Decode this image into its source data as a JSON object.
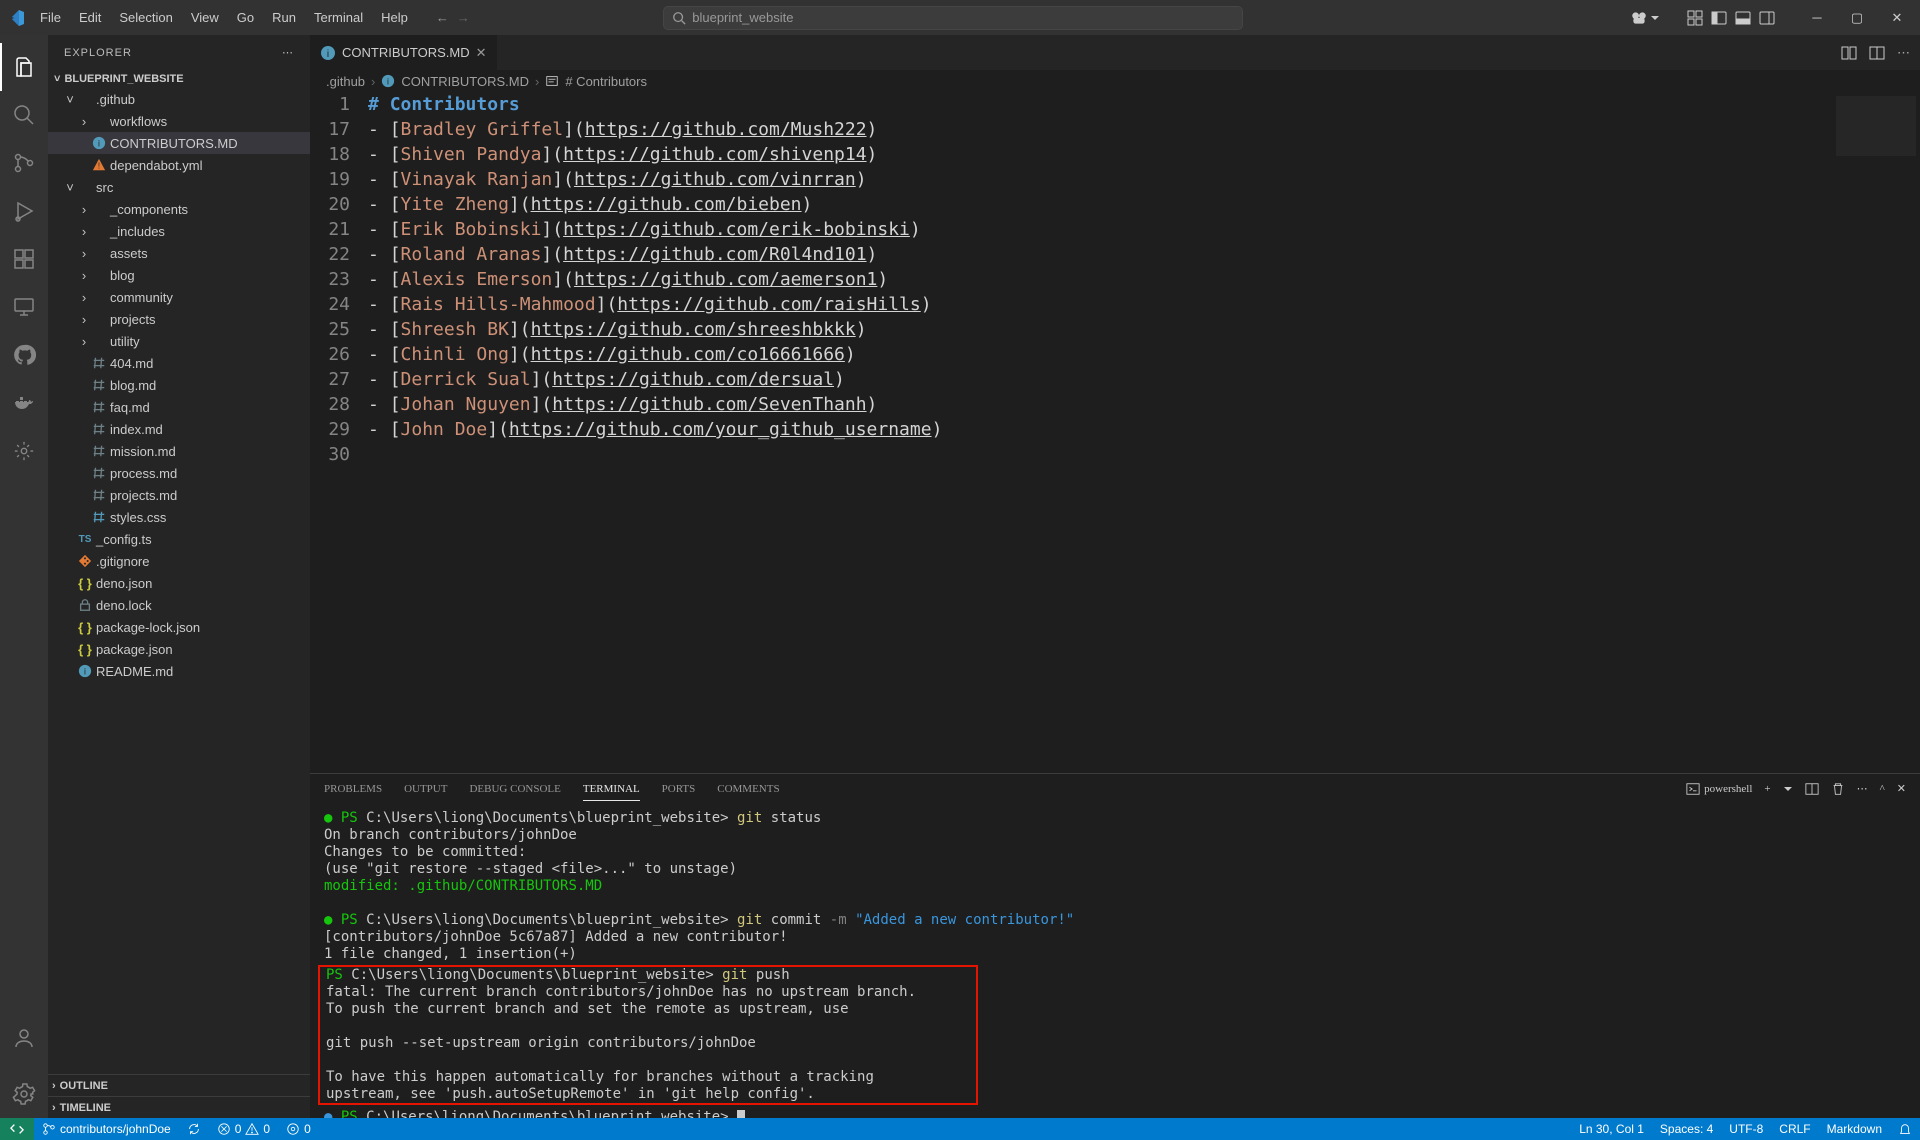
{
  "menu": [
    "File",
    "Edit",
    "Selection",
    "View",
    "Go",
    "Run",
    "Terminal",
    "Help"
  ],
  "search": {
    "placeholder": "blueprint_website"
  },
  "sidebar": {
    "title": "EXPLORER",
    "project": "BLUEPRINT_WEBSITE",
    "outline": "OUTLINE",
    "timeline": "TIMELINE",
    "tree": [
      {
        "indent": 1,
        "chev": "v",
        "icon": "folder",
        "label": ".github",
        "color": "#c09553"
      },
      {
        "indent": 2,
        "chev": ">",
        "icon": "folder",
        "label": "workflows",
        "color": "#c09553"
      },
      {
        "indent": 2,
        "chev": "",
        "icon": "info-blue",
        "label": "CONTRIBUTORS.MD",
        "selected": true,
        "color": "#519aba"
      },
      {
        "indent": 2,
        "chev": "",
        "icon": "exclaim-orange",
        "label": "dependabot.yml",
        "color": "#e37933"
      },
      {
        "indent": 1,
        "chev": "v",
        "icon": "folder",
        "label": "src",
        "color": "#c09553"
      },
      {
        "indent": 2,
        "chev": ">",
        "icon": "folder",
        "label": "_components",
        "color": "#c09553"
      },
      {
        "indent": 2,
        "chev": ">",
        "icon": "folder",
        "label": "_includes",
        "color": "#c09553"
      },
      {
        "indent": 2,
        "chev": ">",
        "icon": "folder",
        "label": "assets",
        "color": "#c09553"
      },
      {
        "indent": 2,
        "chev": ">",
        "icon": "folder",
        "label": "blog",
        "color": "#c09553"
      },
      {
        "indent": 2,
        "chev": ">",
        "icon": "folder",
        "label": "community",
        "color": "#c09553"
      },
      {
        "indent": 2,
        "chev": ">",
        "icon": "folder",
        "label": "projects",
        "color": "#c09553"
      },
      {
        "indent": 2,
        "chev": ">",
        "icon": "folder",
        "label": "utility",
        "color": "#c09553"
      },
      {
        "indent": 2,
        "chev": "",
        "icon": "hash",
        "label": "404.md",
        "color": "#6d8086"
      },
      {
        "indent": 2,
        "chev": "",
        "icon": "hash",
        "label": "blog.md",
        "color": "#6d8086"
      },
      {
        "indent": 2,
        "chev": "",
        "icon": "hash",
        "label": "faq.md",
        "color": "#6d8086"
      },
      {
        "indent": 2,
        "chev": "",
        "icon": "hash",
        "label": "index.md",
        "color": "#6d8086"
      },
      {
        "indent": 2,
        "chev": "",
        "icon": "hash",
        "label": "mission.md",
        "color": "#6d8086"
      },
      {
        "indent": 2,
        "chev": "",
        "icon": "hash",
        "label": "process.md",
        "color": "#6d8086"
      },
      {
        "indent": 2,
        "chev": "",
        "icon": "hash",
        "label": "projects.md",
        "color": "#6d8086"
      },
      {
        "indent": 2,
        "chev": "",
        "icon": "hash",
        "label": "styles.css",
        "color": "#519aba"
      },
      {
        "indent": 1,
        "chev": "",
        "icon": "ts",
        "label": "_config.ts",
        "color": "#519aba"
      },
      {
        "indent": 1,
        "chev": "",
        "icon": "git-orange",
        "label": ".gitignore",
        "color": "#e37933"
      },
      {
        "indent": 1,
        "chev": "",
        "icon": "braces",
        "label": "deno.json",
        "color": "#cbcb41"
      },
      {
        "indent": 1,
        "chev": "",
        "icon": "lock",
        "label": "deno.lock",
        "color": "#6d8086"
      },
      {
        "indent": 1,
        "chev": "",
        "icon": "braces",
        "label": "package-lock.json",
        "color": "#cbcb41"
      },
      {
        "indent": 1,
        "chev": "",
        "icon": "braces",
        "label": "package.json",
        "color": "#cbcb41"
      },
      {
        "indent": 1,
        "chev": "",
        "icon": "info-blue",
        "label": "README.md",
        "color": "#519aba"
      }
    ]
  },
  "tab": {
    "filename": "CONTRIBUTORS.MD"
  },
  "breadcrumbs": {
    "folder": ".github",
    "file": "CONTRIBUTORS.MD",
    "symbol": "# Contributors"
  },
  "editor_lines": [
    {
      "n": 1,
      "heading": true,
      "text": "# Contributors"
    },
    {
      "n": 17,
      "name": "Bradley Griffel",
      "url": "https://github.com/Mush222"
    },
    {
      "n": 18,
      "name": "Shiven Pandya",
      "url": "https://github.com/shivenp14"
    },
    {
      "n": 19,
      "name": "Vinayak Ranjan",
      "url": "https://github.com/vinrran"
    },
    {
      "n": 20,
      "name": "Yite Zheng",
      "url": "https://github.com/bieben"
    },
    {
      "n": 21,
      "name": "Erik Bobinski",
      "url": "https://github.com/erik-bobinski"
    },
    {
      "n": 22,
      "name": "Roland Aranas",
      "url": "https://github.com/R0l4nd101"
    },
    {
      "n": 23,
      "name": "Alexis Emerson",
      "url": "https://github.com/aemerson1"
    },
    {
      "n": 24,
      "name": "Rais Hills-Mahmood",
      "url": "https://github.com/raisHills"
    },
    {
      "n": 25,
      "name": "Shreesh BK",
      "url": "https://github.com/shreeshbkkk"
    },
    {
      "n": 26,
      "name": "Chinli Ong",
      "url": "https://github.com/co16661666"
    },
    {
      "n": 27,
      "name": "Derrick Sual",
      "url": "https://github.com/dersual"
    },
    {
      "n": 28,
      "name": "Johan Nguyen",
      "url": "https://github.com/SevenThanh"
    },
    {
      "n": 29,
      "name": "John Doe",
      "url": "https://github.com/your_github_username"
    },
    {
      "n": 30,
      "blank": true
    }
  ],
  "panel": {
    "tabs": [
      "PROBLEMS",
      "OUTPUT",
      "DEBUG CONSOLE",
      "TERMINAL",
      "PORTS",
      "COMMENTS"
    ],
    "active_tab": "TERMINAL",
    "shell_label": "powershell",
    "prompt": "PS C:\\Users\\liong\\Documents\\blueprint_website>",
    "block1": {
      "cmd": "git status",
      "lines": [
        "On branch contributors/johnDoe",
        "Changes to be committed:",
        "  (use \"git restore --staged <file>...\" to unstage)"
      ],
      "modified_label": "modified:",
      "modified_file": ".github/CONTRIBUTORS.MD"
    },
    "block2": {
      "cmd": "git commit",
      "flag": "-m",
      "msg": "\"Added a new contributor!\"",
      "lines": [
        "[contributors/johnDoe 5c67a87] Added a new contributor!",
        " 1 file changed, 1 insertion(+)"
      ]
    },
    "block3": {
      "cmd": "git push",
      "lines": [
        "fatal: The current branch contributors/johnDoe has no upstream branch.",
        "To push the current branch and set the remote as upstream, use",
        "",
        "    git push --set-upstream origin contributors/johnDoe",
        "",
        "To have this happen automatically for branches without a tracking",
        "upstream, see 'push.autoSetupRemote' in 'git help config'."
      ]
    }
  },
  "status": {
    "branch": "contributors/johnDoe",
    "errors": "0",
    "warnings": "0",
    "ports": "0",
    "lncol": "Ln 30, Col 1",
    "spaces": "Spaces: 4",
    "encoding": "UTF-8",
    "eol": "CRLF",
    "lang": "Markdown"
  }
}
